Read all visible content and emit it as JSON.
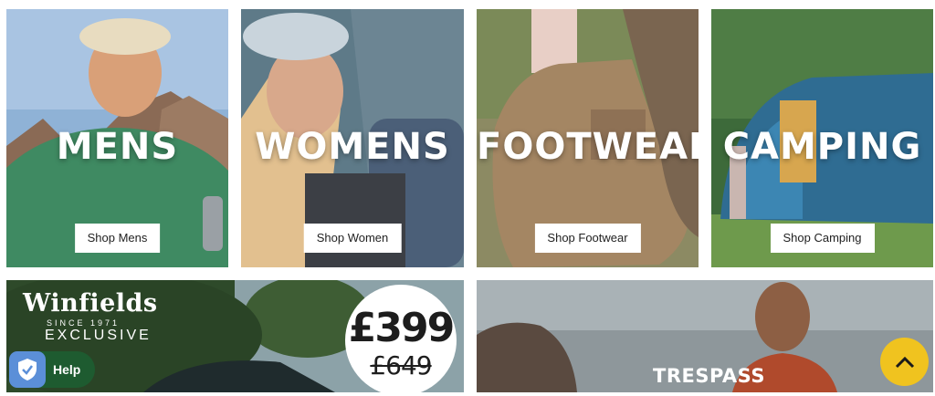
{
  "categories": [
    {
      "title": "MENS",
      "button": "Shop Mens"
    },
    {
      "title": "WOMENS",
      "button": "Shop Women"
    },
    {
      "title": "FOOTWEAR",
      "button": "Shop Footwear"
    },
    {
      "title": "CAMPING",
      "button": "Shop Camping"
    }
  ],
  "promo_winfields": {
    "brand": "Winfields",
    "since": "SINCE 1971",
    "exclusive": "EXCLUSIVE",
    "price_now": "£399",
    "price_was": "£649"
  },
  "promo_trespass": {
    "brand": "TRESPASS"
  },
  "help_widget": {
    "label": "Help",
    "icon": "shield-check-icon"
  },
  "scroll_top": {
    "icon": "chevron-up-icon"
  },
  "colors": {
    "help_bg": "#1e5b30",
    "scroll_top_bg": "#f0c31f"
  }
}
